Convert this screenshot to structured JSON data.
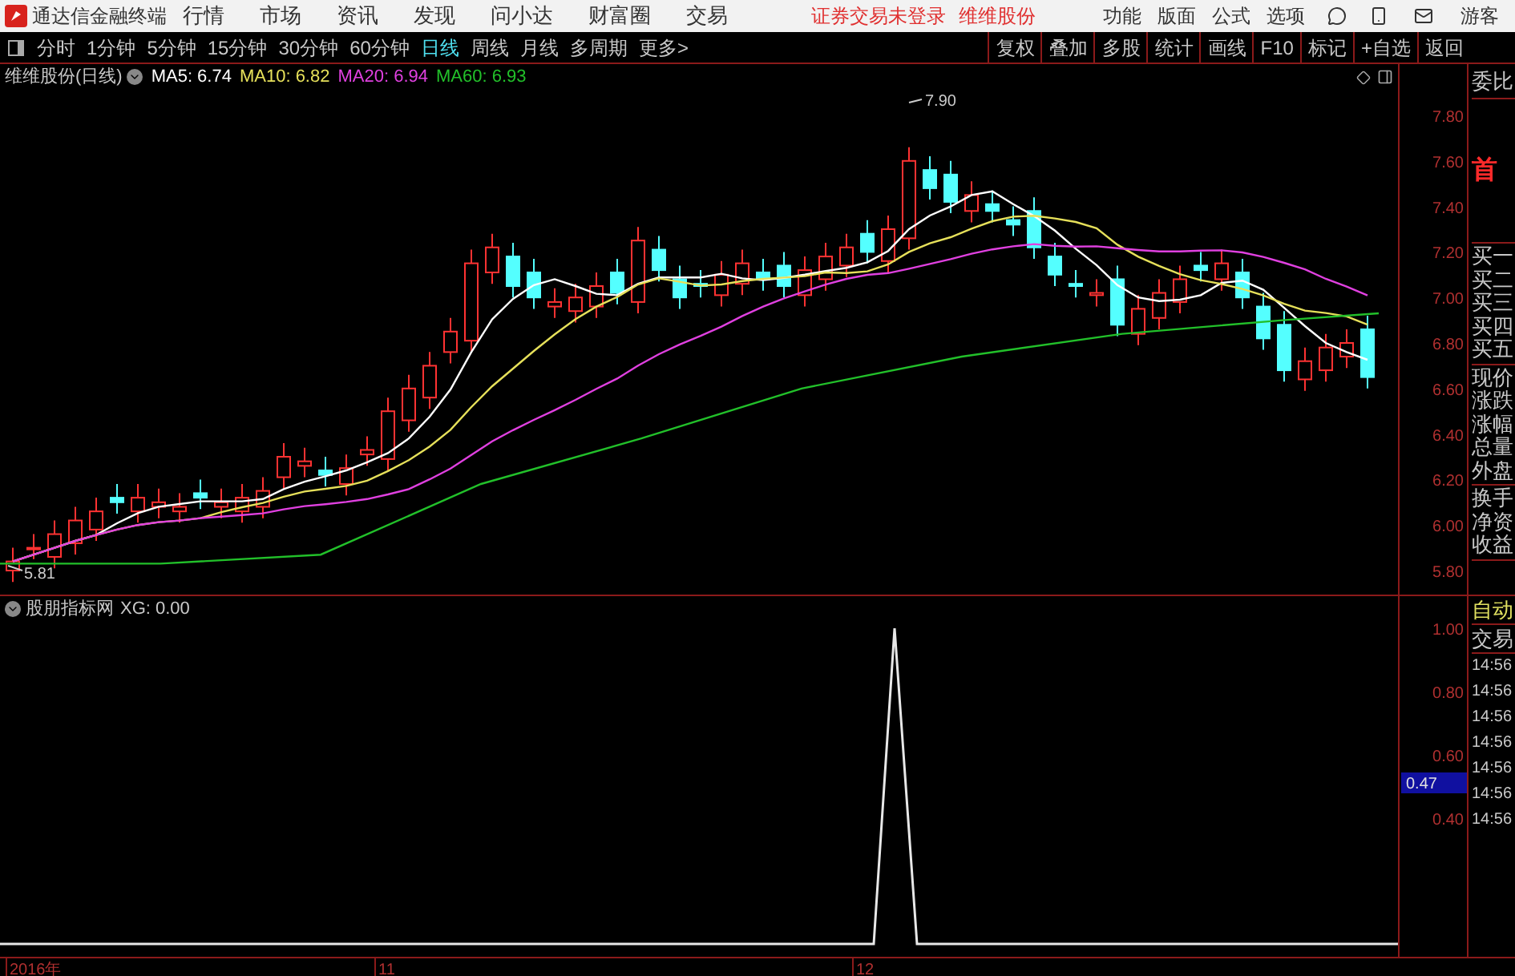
{
  "app": {
    "title": "通达信金融终端",
    "menu": [
      "行情",
      "市场",
      "资讯",
      "发现",
      "问小达",
      "财富圈",
      "交易"
    ],
    "status": [
      "证券交易未登录",
      "维维股份"
    ],
    "right_menu": [
      "功能",
      "版面",
      "公式",
      "选项"
    ],
    "user": "游客"
  },
  "periods": [
    {
      "label": "分时",
      "selected": false
    },
    {
      "label": "1分钟",
      "selected": false
    },
    {
      "label": "5分钟",
      "selected": false
    },
    {
      "label": "15分钟",
      "selected": false
    },
    {
      "label": "30分钟",
      "selected": false
    },
    {
      "label": "60分钟",
      "selected": false
    },
    {
      "label": "日线",
      "selected": true
    },
    {
      "label": "周线",
      "selected": false
    },
    {
      "label": "月线",
      "selected": false
    },
    {
      "label": "多周期",
      "selected": false
    },
    {
      "label": "更多>",
      "selected": false
    }
  ],
  "tools": [
    "复权",
    "叠加",
    "多股",
    "统计",
    "画线",
    "F10",
    "标记",
    "+自选",
    "返回"
  ],
  "main_chart": {
    "title": "维维股份(日线)",
    "ma": [
      {
        "label": "MA5: 6.74",
        "color": "#ffffff"
      },
      {
        "label": "MA10: 6.82",
        "color": "#e6e05a"
      },
      {
        "label": "MA20: 6.94",
        "color": "#e040e0"
      },
      {
        "label": "MA60: 6.93",
        "color": "#22c02a"
      }
    ],
    "high_label": "7.90",
    "low_label": "5.81",
    "price_ticks": [
      "7.80",
      "7.60",
      "7.40",
      "7.20",
      "7.00",
      "6.80",
      "6.60",
      "6.40",
      "6.20",
      "6.00",
      "5.80"
    ]
  },
  "quote_panel": [
    {
      "kind": "header",
      "items": [
        "委比"
      ]
    },
    {
      "kind": "badge",
      "items": [
        "首"
      ]
    },
    {
      "kind": "list",
      "items": [
        "买一",
        "买二",
        "买三",
        "买四",
        "买五"
      ]
    },
    {
      "kind": "list",
      "items": [
        "现价",
        "涨跌",
        "涨幅",
        "总量",
        "外盘"
      ]
    },
    {
      "kind": "list",
      "items": [
        "换手",
        "净资",
        "收益"
      ]
    }
  ],
  "indicator": {
    "title": "股朋指标网",
    "reading": "XG: 0.00",
    "ticks": [
      "1.00",
      "0.80",
      "0.60",
      "0.40"
    ],
    "cursor_value": "0.47"
  },
  "trade_panel": {
    "title": "自动",
    "subtitle": "交易",
    "times": [
      "14:56",
      "14:56",
      "14:56",
      "14:56",
      "14:56",
      "14:56",
      "14:56"
    ]
  },
  "date_axis": [
    "2016年",
    "11",
    "12"
  ]
}
